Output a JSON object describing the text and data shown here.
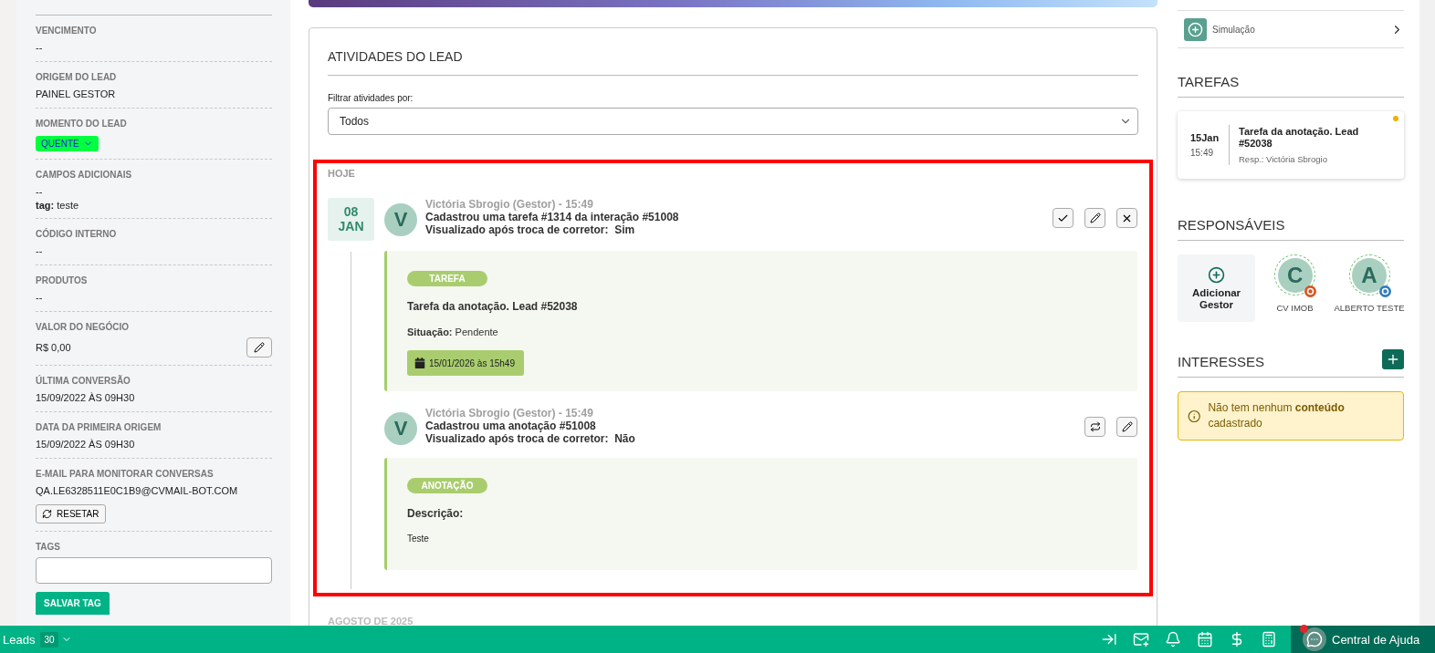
{
  "sidebar": {
    "fields": [
      {
        "label": "VENCIMENTO",
        "kind": "text",
        "value": "--"
      },
      {
        "label": "ORIGEM DO LEAD",
        "kind": "text",
        "value": "PAINEL GESTOR"
      },
      {
        "label": "MOMENTO DO LEAD",
        "kind": "dropdown",
        "value": "QUENTE"
      },
      {
        "label": "CAMPOS ADICIONAIS",
        "kind": "text",
        "value": "--",
        "extra": "**tag:** teste"
      },
      {
        "label": "CÓDIGO INTERNO",
        "kind": "text",
        "value": "--"
      },
      {
        "label": "PRODUTOS",
        "kind": "text",
        "value": "--"
      },
      {
        "label": "VALOR DO NEGÓCIO",
        "kind": "editable",
        "value": "R$ 0,00"
      },
      {
        "label": "ÚLTIMA CONVERSÃO",
        "kind": "text",
        "value": "15/09/2022 ÀS 09H30"
      },
      {
        "label": "DATA DA PRIMEIRA ORIGEM",
        "kind": "text",
        "value": "15/09/2022 ÀS 09H30"
      },
      {
        "label": "E-MAIL PARA MONITORAR CONVERSAS",
        "kind": "email",
        "value": "QA.LE6328511E0C1B9@CVMAIL-BOT.COM",
        "button": "RESETAR"
      },
      {
        "label": "TAGS",
        "kind": "input",
        "button": "SALVAR TAG"
      }
    ]
  },
  "activities": {
    "title": "ATIVIDADES DO LEAD",
    "filter_label": "Filtrar atividades por:",
    "filter_value": "Todos",
    "group": "HOJE",
    "date_day": "08",
    "date_month": "JAN",
    "items": [
      {
        "kind": "task",
        "avatar": "V",
        "author": "Victória Sbrogio (Gestor) - 15:49",
        "title": "Cadastrou uma tarefa #1314 da interação #51008",
        "viewed_label": "Visualizado após troca de corretor:",
        "viewed": "Sim",
        "actions": [
          {
            "kind": "check"
          },
          {
            "kind": "edit"
          },
          {
            "kind": "close"
          }
        ],
        "card": {
          "tag": "TAREFA",
          "heading": "Tarefa da anotação. Lead #52038",
          "status_label": "Situação:",
          "status": "Pendente",
          "due": "15/01/2026 às 15h49"
        }
      },
      {
        "kind": "note",
        "avatar": "V",
        "author": "Victória Sbrogio (Gestor) - 15:49",
        "title": "Cadastrou uma anotação #51008",
        "viewed_label": "Visualizado após troca de corretor:",
        "viewed": "Não",
        "actions": [
          {
            "kind": "transfer"
          },
          {
            "kind": "edit"
          }
        ],
        "card": {
          "tag": "ANOTAÇÃO",
          "heading": "Descrição:",
          "body": "Teste"
        }
      }
    ],
    "next_group": "AGOSTO DE 2025"
  },
  "right": {
    "simulation": "Simulação",
    "tasks": {
      "title": "TAREFAS",
      "day": "15Jan",
      "time": "15:49",
      "task": "Tarefa da anotação. Lead #52038",
      "resp": "Resp.: Victória Sbrogio"
    },
    "responsibles": {
      "title": "RESPONSÁVEIS",
      "add": "Adicionar Gestor",
      "people": [
        {
          "initial": "C",
          "name": "CV IMOB",
          "color": "#d9541e"
        },
        {
          "initial": "A",
          "name": "ALBERTO TESTE",
          "color": "#2f7bc0"
        }
      ]
    },
    "interests": {
      "title": "INTERESSES",
      "notice": "Não tem nenhum **conteúdo** cadastrado"
    }
  },
  "bottom_bar": {
    "label": "Leads",
    "count": "30",
    "icons": [
      {
        "kind": "collapse"
      },
      {
        "kind": "mail"
      },
      {
        "kind": "bell"
      },
      {
        "kind": "calendar"
      },
      {
        "kind": "dollar"
      },
      {
        "kind": "calculator"
      }
    ],
    "help": "Central de Ajuda"
  }
}
